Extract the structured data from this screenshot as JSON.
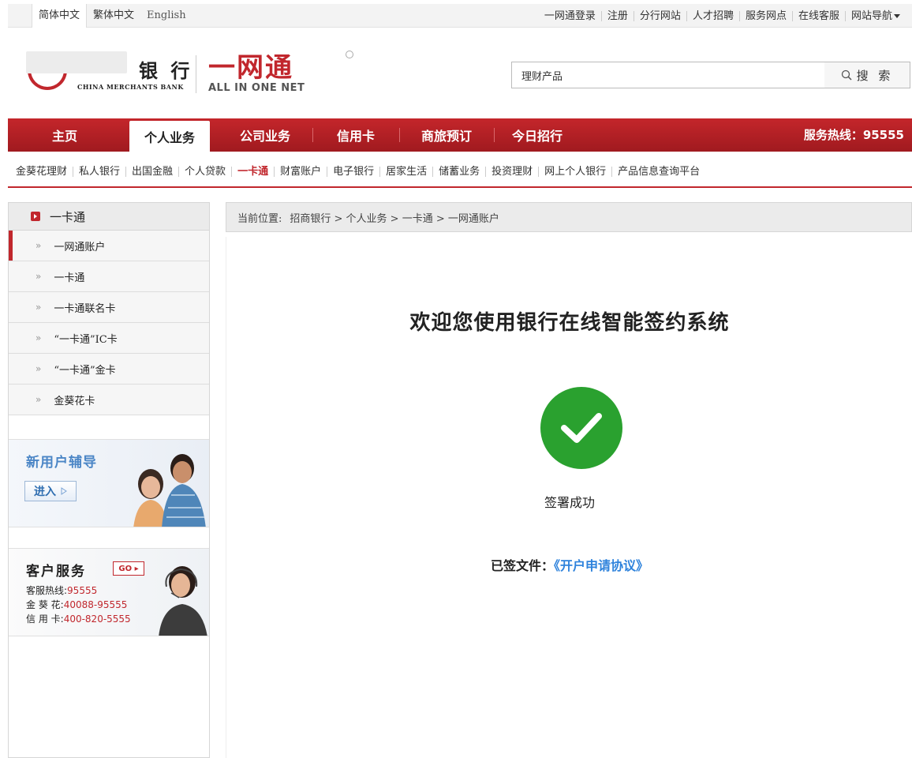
{
  "lang": {
    "items": [
      "简体中文",
      "繁体中文",
      "English"
    ]
  },
  "toplinks": [
    "一网通登录",
    "注册",
    "分行网站",
    "人才招聘",
    "服务网点",
    "在线客服",
    "网站导航"
  ],
  "header": {
    "bank_name": "银 行",
    "bank_name_en": "CHINA MERCHANTS BANK",
    "product_cn": "一网通",
    "product_en": "ALL IN ONE NET",
    "search_value": "理财产品",
    "search_button": "搜 索"
  },
  "mainnav": {
    "items": [
      "主页",
      "个人业务",
      "公司业务",
      "信用卡",
      "商旅预订",
      "今日招行"
    ],
    "active_index": 1,
    "hotline": "服务热线：95555"
  },
  "subnav": {
    "items": [
      "金葵花理财",
      "私人银行",
      "出国金融",
      "个人贷款",
      "一卡通",
      "财富账户",
      "电子银行",
      "居家生活",
      "储蓄业务",
      "投资理财",
      "网上个人银行",
      "产品信息查询平台"
    ],
    "active": "一卡通"
  },
  "sidebar": {
    "title": "一卡通",
    "items": [
      "一网通账户",
      "一卡通",
      "一卡通联名卡",
      "“一卡通”IC卡",
      "“一卡通”金卡",
      "金葵花卡"
    ],
    "promo_title": "新用户辅导",
    "promo_button": "进入",
    "cs_title": "客户服务",
    "cs_go": "GO",
    "cs_lines": [
      {
        "label": "客服热线:",
        "value": "95555"
      },
      {
        "label": "金 葵 花:",
        "value": "40088-95555"
      },
      {
        "label": "信 用 卡:",
        "value": "400-820-5555"
      }
    ]
  },
  "breadcrumb": {
    "label": "当前位置:",
    "path": "招商银行 > 个人业务 > 一卡通 > 一网通账户"
  },
  "content": {
    "welcome": "欢迎您使用银行在线智能签约系统",
    "status": "签署成功",
    "signed_label": "已签文件：",
    "signed_doc": "《开户申请协议》"
  },
  "colors": {
    "brand_red": "#c1272d",
    "success_green": "#2aa12f",
    "link_blue": "#2f83dc"
  }
}
